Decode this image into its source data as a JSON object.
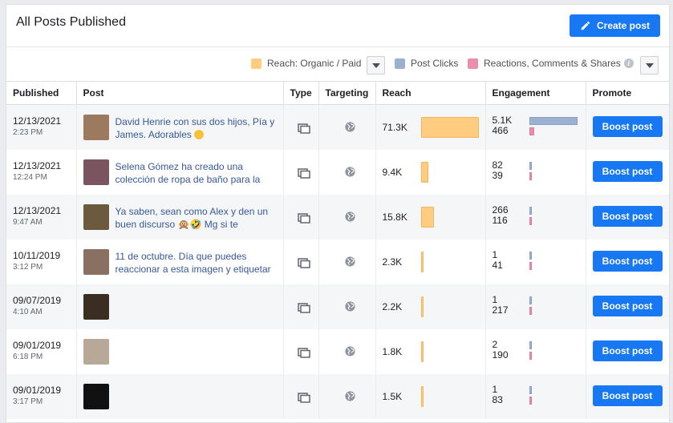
{
  "header": {
    "title": "All Posts Published",
    "create_label": "Create post"
  },
  "legend": {
    "reach_label": "Reach: Organic / Paid",
    "clicks_label": "Post Clicks",
    "reactions_label": "Reactions, Comments & Shares",
    "info_glyph": "i",
    "colors": {
      "reach": "#ffcc80",
      "clicks": "#9cb0d0",
      "reactions": "#ea8ea9"
    }
  },
  "columns": [
    "Published",
    "Post",
    "Type",
    "Targeting",
    "Reach",
    "Engagement",
    "Promote"
  ],
  "boost_label": "Boost post",
  "rows": [
    {
      "date": "12/13/2021",
      "time": "2:23 PM",
      "text": "David Henrie con sus dos hijos, Pía y James. Adorables",
      "emoji": true,
      "reach": "71.3K",
      "reach_value": 71.3,
      "clicks": "5.1K",
      "reactions": "466",
      "clicks_value": 5100,
      "reactions_value": 466,
      "thumb": "#9b7a5e"
    },
    {
      "date": "12/13/2021",
      "time": "12:24 PM",
      "text": "Selena Gómez ha creado una colección de ropa de baño para la",
      "emoji": false,
      "reach": "9.4K",
      "reach_value": 9.4,
      "clicks": "82",
      "reactions": "39",
      "clicks_value": 82,
      "reactions_value": 39,
      "thumb": "#7a5560"
    },
    {
      "date": "12/13/2021",
      "time": "9:47 AM",
      "text": "Ya saben, sean como Alex y den un buen discurso 🙊🤣 Mg si te",
      "emoji": false,
      "reach": "15.8K",
      "reach_value": 15.8,
      "clicks": "266",
      "reactions": "116",
      "clicks_value": 266,
      "reactions_value": 116,
      "thumb": "#6b5a3e"
    },
    {
      "date": "10/11/2019",
      "time": "3:12 PM",
      "text": "11 de octubre. Día que puedes reaccionar a esta imagen y etiquetar",
      "emoji": false,
      "reach": "2.3K",
      "reach_value": 2.3,
      "clicks": "1",
      "reactions": "41",
      "clicks_value": 1,
      "reactions_value": 41,
      "thumb": "#8a7060"
    },
    {
      "date": "09/07/2019",
      "time": "4:10 AM",
      "text": "",
      "emoji": false,
      "reach": "2.2K",
      "reach_value": 2.2,
      "clicks": "1",
      "reactions": "217",
      "clicks_value": 1,
      "reactions_value": 217,
      "thumb": "#3a2e22"
    },
    {
      "date": "09/01/2019",
      "time": "6:18 PM",
      "text": "",
      "emoji": false,
      "reach": "1.8K",
      "reach_value": 1.8,
      "clicks": "2",
      "reactions": "190",
      "clicks_value": 2,
      "reactions_value": 190,
      "thumb": "#b8a898"
    },
    {
      "date": "09/01/2019",
      "time": "3:17 PM",
      "text": "",
      "emoji": false,
      "reach": "1.5K",
      "reach_value": 1.5,
      "clicks": "1",
      "reactions": "83",
      "clicks_value": 1,
      "reactions_value": 83,
      "thumb": "#111111"
    }
  ]
}
